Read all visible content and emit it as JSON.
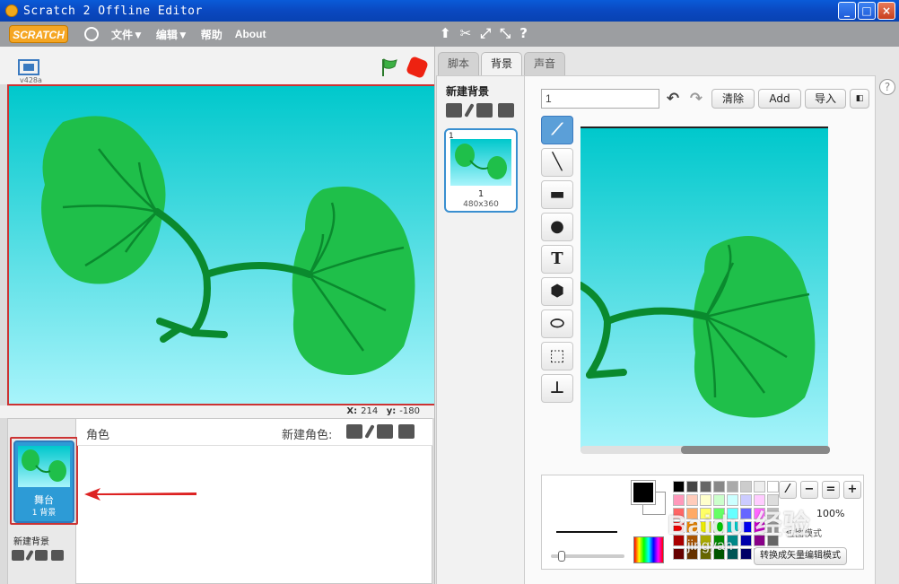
{
  "window": {
    "title": "Scratch 2 Offline Editor"
  },
  "menubar": {
    "logo": "SCRATCH",
    "items": [
      "文件▼",
      "编辑▼",
      "帮助",
      "About"
    ]
  },
  "stage": {
    "version": "v428a",
    "coords": {
      "x_label": "X:",
      "x": "214",
      "y_label": "y:",
      "y": "-180"
    }
  },
  "sprites": {
    "header": "角色",
    "new_sprite": "新建角色:",
    "stage_name": "舞台",
    "stage_sub": "1 背景",
    "new_backdrop": "新建背景"
  },
  "tabs": [
    "脚本",
    "背景",
    "声音"
  ],
  "backdrops": {
    "new_label": "新建背景",
    "items": [
      {
        "index": "1",
        "name": "1",
        "size": "480x360"
      }
    ]
  },
  "paint_editor": {
    "costume_name": "1",
    "clear": "清除",
    "add": "Add",
    "import": "导入",
    "zoom": "100%",
    "convert_label": "位图模式",
    "convert_button": "转换成矢量编辑模式"
  },
  "watermark": {
    "main": "Baidu 经验",
    "sub": "jingyan"
  },
  "colors": {
    "accent": "#3a8fd0",
    "sky_top": "#00c8cc",
    "sky_bottom": "#a8f4fb",
    "leaf": "#1fbf4a",
    "stem": "#0a8a2e",
    "highlight": "#cc3333"
  },
  "icons": [
    "globe-icon",
    "duplicate-icon",
    "cut-icon",
    "grow-icon",
    "shrink-icon",
    "help-icon",
    "green-flag-icon",
    "stop-icon",
    "fullscreen-icon"
  ]
}
